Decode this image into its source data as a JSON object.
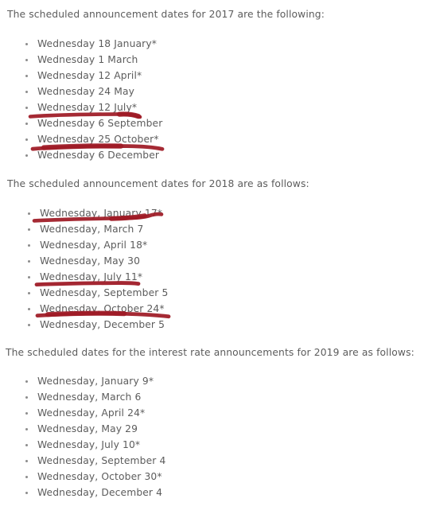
{
  "document": {
    "type": "web-article-excerpt",
    "background_color": "#ffffff",
    "text_color": "#5c5c5c",
    "annotation_color": "#9e1a25"
  },
  "sections": [
    {
      "id": "2017",
      "intro": "The scheduled announcement dates for 2017 are the following:",
      "items": [
        "Wednesday 18 January*",
        "Wednesday 1 March",
        "Wednesday 12 April*",
        "Wednesday 24 May",
        "Wednesday 12 July*",
        "Wednesday 6 September",
        "Wednesday 25 October*",
        "Wednesday 6 December"
      ]
    },
    {
      "id": "2018",
      "intro": "The scheduled announcement dates for 2018 are as follows:",
      "items": [
        "Wednesday, January 17*",
        "Wednesday, March 7",
        "Wednesday, April 18*",
        "Wednesday, May 30",
        "Wednesday, July 11*",
        "Wednesday, September 5",
        "Wednesday, October 24*",
        "Wednesday, December 5"
      ]
    },
    {
      "id": "2019",
      "intro": "The scheduled dates for the interest rate announcements for 2019 are as follows:",
      "items": [
        "Wednesday, January 9*",
        "Wednesday, March 6",
        "Wednesday, April 24*",
        "Wednesday, May 29",
        "Wednesday, July 10*",
        "Wednesday, September 4",
        "Wednesday, October 30*",
        "Wednesday, December 4"
      ]
    }
  ],
  "annotations": {
    "color": "#9e1a25",
    "count": 5,
    "marks": [
      {
        "target": "Wednesday 12 July*",
        "section": "2017"
      },
      {
        "target": "Wednesday 25 October*",
        "section": "2017"
      },
      {
        "target": "Wednesday, January 17*",
        "section": "2018"
      },
      {
        "target": "Wednesday, July 11*",
        "section": "2018"
      },
      {
        "target": "Wednesday, October 24*",
        "section": "2018"
      }
    ]
  }
}
